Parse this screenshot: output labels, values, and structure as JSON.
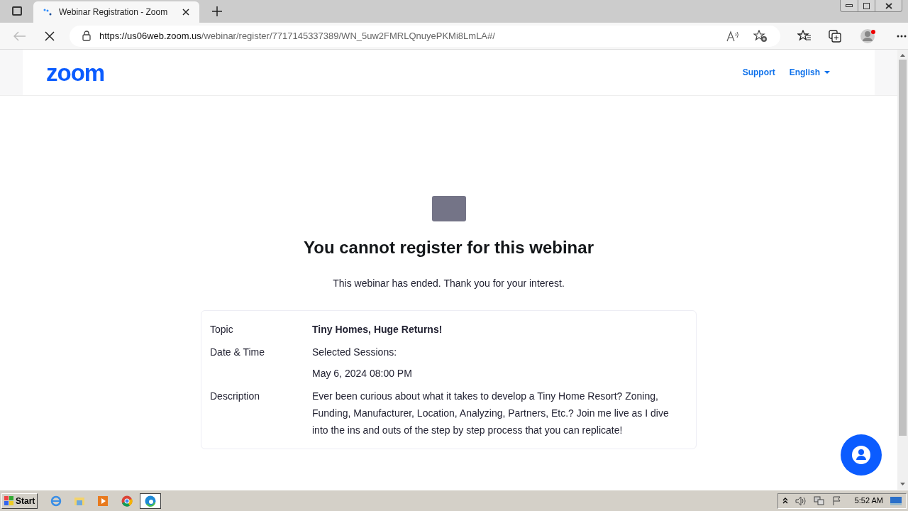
{
  "browser": {
    "tab_title": "Webinar Registration - Zoom",
    "url_host": "https://us06web.zoom.us",
    "url_path": "/webinar/register/7717145337389/WN_5uw2FMRLQnuyePKMi8LmLA#/",
    "loading": true
  },
  "header": {
    "logo": "zoom",
    "links": [
      {
        "label": "Support",
        "kind": "link"
      },
      {
        "label": "English",
        "kind": "dropdown"
      }
    ]
  },
  "message": {
    "title": "You cannot register for this webinar",
    "subtitle": "This webinar has ended. Thank you for your interest."
  },
  "details": [
    {
      "label": "Topic",
      "lines": [
        "Tiny Homes, Huge Returns!"
      ],
      "bold": true
    },
    {
      "label": "Date & Time",
      "lines": [
        "Selected Sessions:",
        "May 6, 2024 08:00 PM"
      ],
      "bold": false
    },
    {
      "label": "Description",
      "lines": [
        "Ever been curious about what it takes to develop a Tiny Home Resort? Zoning, Funding, Manufacturer, Location, Analyzing, Partners, Etc.? Join me live as I dive into the ins and outs of the step by step process that you can replicate!"
      ],
      "bold": false
    }
  ],
  "taskbar": {
    "start": "Start",
    "clock": "5:52 AM"
  }
}
